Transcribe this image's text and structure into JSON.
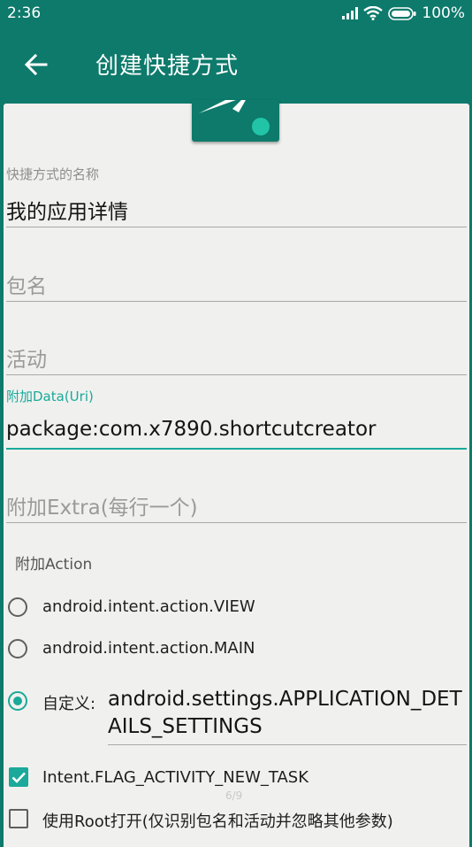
{
  "status_bar": {
    "time": "2:36",
    "battery": "100%"
  },
  "app_bar": {
    "title": "创建快捷方式"
  },
  "form": {
    "name": {
      "label": "快捷方式的名称",
      "value": "我的应用详情"
    },
    "package": {
      "placeholder": "包名"
    },
    "activity": {
      "placeholder": "活动"
    },
    "data_uri": {
      "label": "附加Data(Uri)",
      "value": "package:com.x7890.shortcutcreator"
    },
    "extra": {
      "placeholder": "附加Extra(每行一个)"
    }
  },
  "action_section": {
    "label": "附加Action",
    "options": [
      {
        "label": "android.intent.action.VIEW",
        "checked": false
      },
      {
        "label": "android.intent.action.MAIN",
        "checked": false
      },
      {
        "label": "自定义:",
        "checked": true,
        "value": "android.settings.APPLICATION_DETAILS_SETTINGS"
      }
    ]
  },
  "flags": [
    {
      "label": "Intent.FLAG_ACTIVITY_NEW_TASK",
      "checked": true
    },
    {
      "label": "使用Root打开(仅识别包名和活动并忽略其他参数)",
      "checked": false
    }
  ],
  "page_indicator": "6/9",
  "colors": {
    "primary": "#0d7a6b",
    "accent": "#1aa99a",
    "card": "#f0f1ee"
  }
}
